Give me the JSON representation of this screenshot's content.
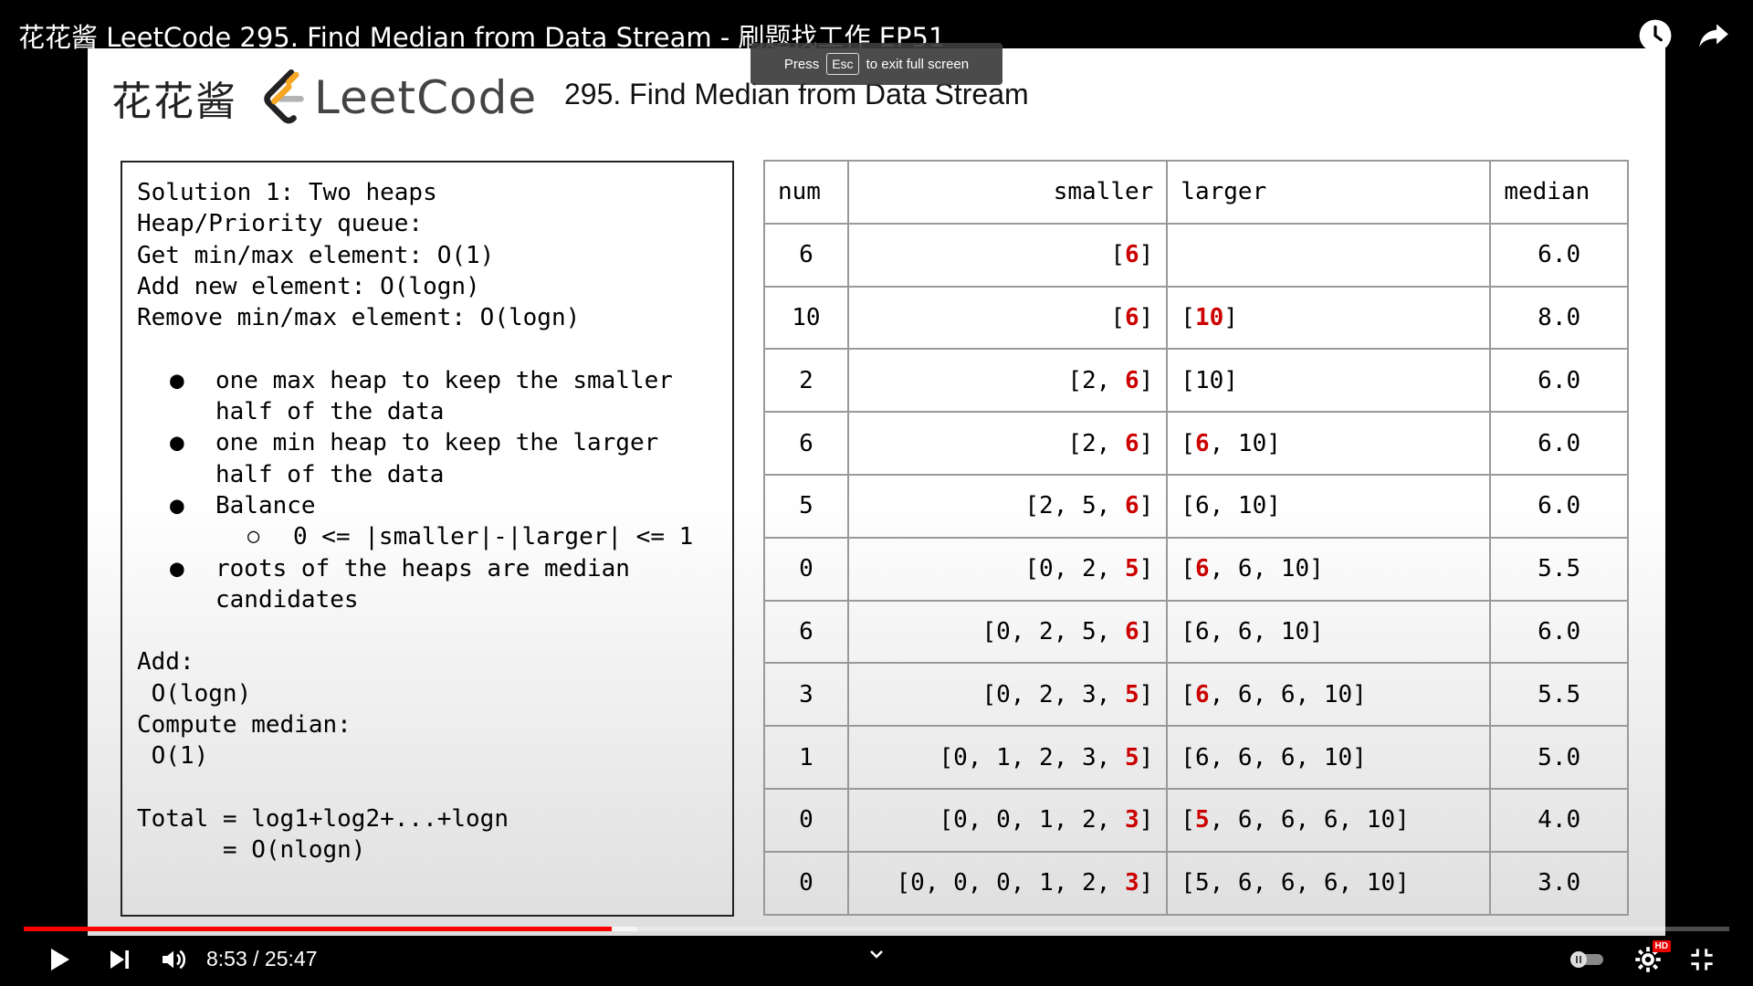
{
  "video": {
    "title": "花花酱 LeetCode 295. Find Median from Data Stream - 刷题找工作 EP51",
    "toast_press": "Press",
    "toast_key": "Esc",
    "toast_suffix": "to exit full screen",
    "time_display": "8:53 / 25:47",
    "progress_fraction": 0.3445,
    "buffer_fraction": 0.3595
  },
  "slide": {
    "brand_cn": "花花酱",
    "brand_logo_text": "LeetCode",
    "problem_title": "295. Find Median from Data Stream",
    "left_box": {
      "lines": [
        "Solution 1: Two heaps",
        "Heap/Priority queue:",
        "Get min/max element: O(1)",
        "Add new element: O(logn)",
        "Remove min/max element: O(logn)"
      ],
      "bullets": [
        "one max heap to keep the smaller",
        "half of the data",
        "one min heap to keep the larger",
        "half of the data",
        "Balance",
        "roots of the heaps are median",
        "candidates"
      ],
      "sub_bullet": "0 <= |smaller|-|larger| <= 1",
      "bullet_symbol": "●",
      "sub_bullet_symbol": "○",
      "add_lines": [
        "Add:",
        " O(logn)",
        "Compute median:",
        " O(1)"
      ],
      "total_lines": [
        "Total = log1+log2+...+logn",
        "      = O(nlogn)"
      ]
    },
    "table": {
      "headers": {
        "num": "num",
        "smaller": "smaller",
        "larger": "larger",
        "median": "median"
      },
      "rows": [
        {
          "num": "6",
          "smaller_pre": "[",
          "smaller_red": "6",
          "smaller_post": "]",
          "larger_pre": "",
          "larger_red": "",
          "larger_post": "",
          "median": "6.0"
        },
        {
          "num": "10",
          "smaller_pre": "[",
          "smaller_red": "6",
          "smaller_post": "]",
          "larger_pre": "[",
          "larger_red": "10",
          "larger_post": "]",
          "median": "8.0"
        },
        {
          "num": "2",
          "smaller_pre": "[2, ",
          "smaller_red": "6",
          "smaller_post": "]",
          "larger_pre": "[10]",
          "larger_red": "",
          "larger_post": "",
          "median": "6.0"
        },
        {
          "num": "6",
          "smaller_pre": "[2, ",
          "smaller_red": "6",
          "smaller_post": "]",
          "larger_pre": "[",
          "larger_red": "6",
          "larger_post": ", 10]",
          "median": "6.0"
        },
        {
          "num": "5",
          "smaller_pre": "[2, 5, ",
          "smaller_red": "6",
          "smaller_post": "]",
          "larger_pre": "[6, 10]",
          "larger_red": "",
          "larger_post": "",
          "median": "6.0"
        },
        {
          "num": "0",
          "smaller_pre": "[0, 2, ",
          "smaller_red": "5",
          "smaller_post": "]",
          "larger_pre": "[",
          "larger_red": "6",
          "larger_post": ", 6, 10]",
          "median": "5.5"
        },
        {
          "num": "6",
          "smaller_pre": "[0, 2, 5, ",
          "smaller_red": "6",
          "smaller_post": "]",
          "larger_pre": "[6, 6, 10]",
          "larger_red": "",
          "larger_post": "",
          "median": "6.0"
        },
        {
          "num": "3",
          "smaller_pre": "[0, 2, 3, ",
          "smaller_red": "5",
          "smaller_post": "]",
          "larger_pre": "[",
          "larger_red": "6",
          "larger_post": ", 6, 6, 10]",
          "median": "5.5"
        },
        {
          "num": "1",
          "smaller_pre": "[0, 1, 2, 3, ",
          "smaller_red": "5",
          "smaller_post": "]",
          "larger_pre": "[6, 6, 6, 10]",
          "larger_red": "",
          "larger_post": "",
          "median": "5.0"
        },
        {
          "num": "0",
          "smaller_pre": "[0, 0, 1, 2, ",
          "smaller_red": "3",
          "smaller_post": "]",
          "larger_pre": "[",
          "larger_red": "5",
          "larger_post": ", 6, 6, 6, 10]",
          "median": "4.0"
        },
        {
          "num": "0",
          "smaller_pre": "[0, 0, 0, 1, 2, ",
          "smaller_red": "3",
          "smaller_post": "]",
          "larger_pre": "[5, 6, 6, 6, 10]",
          "larger_red": "",
          "larger_post": "",
          "median": "3.0"
        }
      ]
    }
  },
  "controls": {
    "hd_badge": "HD",
    "icons": [
      "play-icon",
      "next-icon",
      "volume-icon",
      "chevron-down-icon",
      "autoplay-toggle-icon",
      "settings-icon",
      "exit-fullscreen-icon",
      "watch-later-icon",
      "share-icon"
    ]
  },
  "colors": {
    "accent_red": "#cc0000",
    "progress_red": "#ff0000",
    "logo_orange": "#f5a623"
  }
}
